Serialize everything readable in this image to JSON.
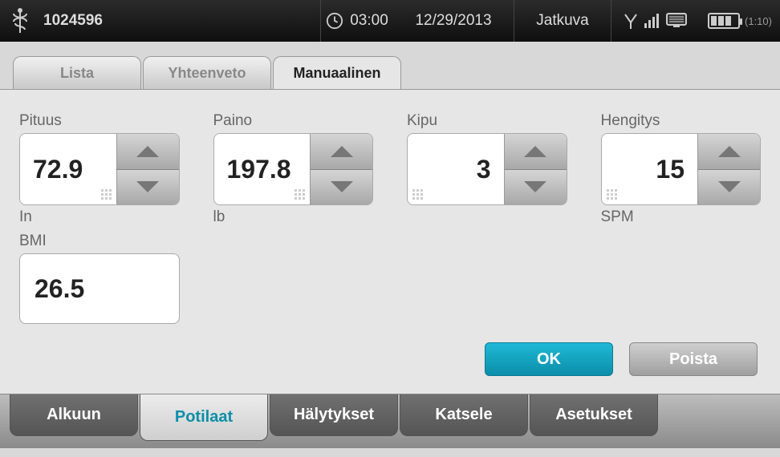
{
  "header": {
    "patient_id": "1024596",
    "time": "03:00",
    "date": "12/29/2013",
    "mode": "Jatkuva",
    "battery_label": "(1:10)"
  },
  "tabs": [
    {
      "label": "Lista"
    },
    {
      "label": "Yhteenveto"
    },
    {
      "label": "Manuaalinen"
    }
  ],
  "fields": {
    "height": {
      "label": "Pituus",
      "value": "72.9",
      "unit": "In"
    },
    "weight": {
      "label": "Paino",
      "value": "197.8",
      "unit": "lb"
    },
    "pain": {
      "label": "Kipu",
      "value": "3",
      "unit": ""
    },
    "resp": {
      "label": "Hengitys",
      "value": "15",
      "unit": "SPM"
    },
    "bmi": {
      "label": "BMI",
      "value": "26.5"
    }
  },
  "buttons": {
    "ok": "OK",
    "delete": "Poista"
  },
  "nav": [
    {
      "label": "Alkuun"
    },
    {
      "label": "Potilaat"
    },
    {
      "label": "Hälytykset"
    },
    {
      "label": "Katsele"
    },
    {
      "label": "Asetukset"
    }
  ]
}
